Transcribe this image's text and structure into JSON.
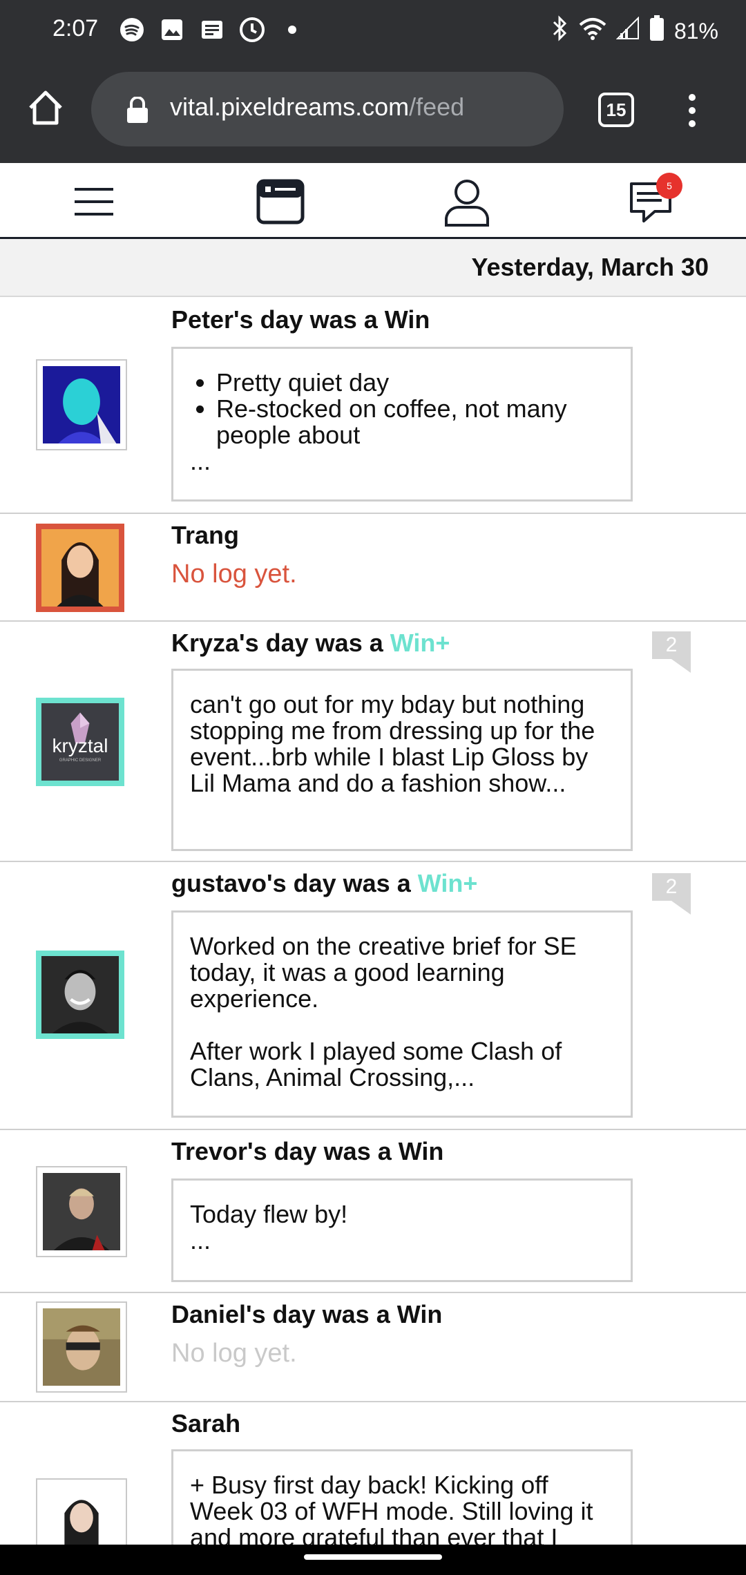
{
  "status_bar": {
    "time": "2:07",
    "battery": "81%",
    "icons": [
      "spotify-icon",
      "image-icon",
      "news-icon",
      "clock-icon",
      "dot-icon",
      "bluetooth-icon",
      "wifi-icon",
      "signal-icon",
      "battery-icon"
    ]
  },
  "browser": {
    "url_host": "vital.pixeldreams.com",
    "url_path": "/feed",
    "tab_count": "15"
  },
  "app_nav": {
    "notification_count": "5"
  },
  "feed": {
    "date_header": "Yesterday, March 30",
    "entries": [
      {
        "title": "Peter's day was a Win",
        "bullets": [
          "Pretty quiet day",
          "Re-stocked on coffee, not many people about"
        ],
        "ellipsis": "..."
      },
      {
        "title": "Trang",
        "status": "No log yet."
      },
      {
        "title_prefix": "Kryza's day was a ",
        "title_accent": "Win+",
        "comments": "2",
        "text": "can't go out for my bday but nothing stopping me from dressing up for the event...brb while I blast Lip Gloss by Lil Mama and do a fashion show...",
        "avatar_logo": "kryztal",
        "avatar_tagline": "GRAPHIC DESIGNER"
      },
      {
        "title_prefix": "gustavo's day was a ",
        "title_accent": "Win+",
        "comments": "2",
        "text_p1": "Worked on the creative brief for SE today, it was a good learning experience.",
        "text_p2": "After work I played some Clash of Clans, Animal Crossing,..."
      },
      {
        "title": "Trevor's day was a Win",
        "text": "Today flew by!",
        "ellipsis": "..."
      },
      {
        "title": "Daniel's day was a Win",
        "status": "No log yet."
      },
      {
        "title": "Sarah",
        "text": "+ Busy first day back! Kicking off Week 03 of WFH mode. Still loving it and more grateful than ever that I"
      }
    ]
  },
  "colors": {
    "accent": "#6de2cf",
    "alert": "#d9543d",
    "badge": "#e6322d",
    "chrome": "#2f3033"
  }
}
